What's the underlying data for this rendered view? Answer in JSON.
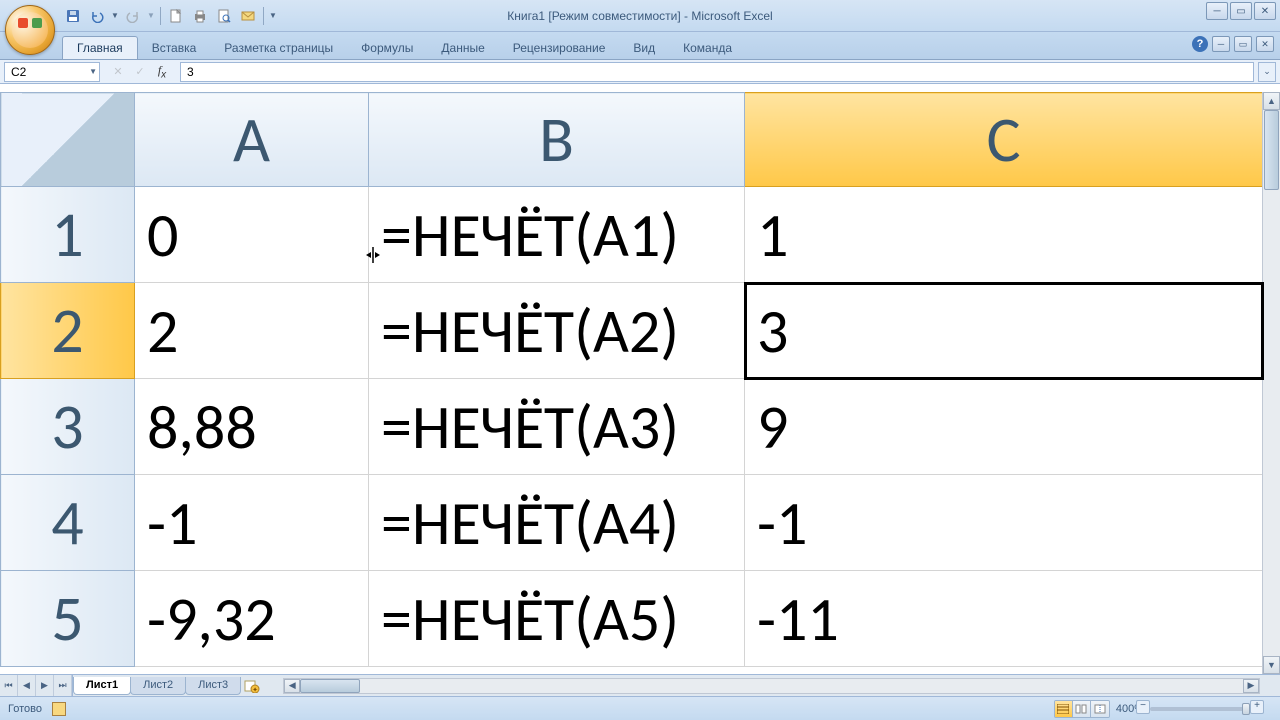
{
  "title": "Книга1  [Режим совместимости] - Microsoft Excel",
  "ribbon": {
    "tabs": [
      "Главная",
      "Вставка",
      "Разметка страницы",
      "Формулы",
      "Данные",
      "Рецензирование",
      "Вид",
      "Команда"
    ],
    "active_index": 0
  },
  "name_box": "C2",
  "formula_value": "3",
  "columns": [
    "A",
    "B",
    "C"
  ],
  "selected_column_index": 2,
  "selected_row_index": 1,
  "active_cell": "C2",
  "rows": [
    {
      "num": "1",
      "A": "0",
      "B": "=НЕЧЁТ(A1)",
      "C": "1"
    },
    {
      "num": "2",
      "A": "2",
      "B": "=НЕЧЁТ(A2)",
      "C": "3"
    },
    {
      "num": "3",
      "A": "8,88",
      "B": "=НЕЧЁТ(A3)",
      "C": "9"
    },
    {
      "num": "4",
      "A": "-1",
      "B": "=НЕЧЁТ(A4)",
      "C": "-1"
    },
    {
      "num": "5",
      "A": "-9,32",
      "B": "=НЕЧЁТ(A5)",
      "C": "-11"
    }
  ],
  "sheet_tabs": [
    "Лист1",
    "Лист2",
    "Лист3"
  ],
  "active_sheet_index": 0,
  "status_text": "Готово",
  "zoom": "400%"
}
